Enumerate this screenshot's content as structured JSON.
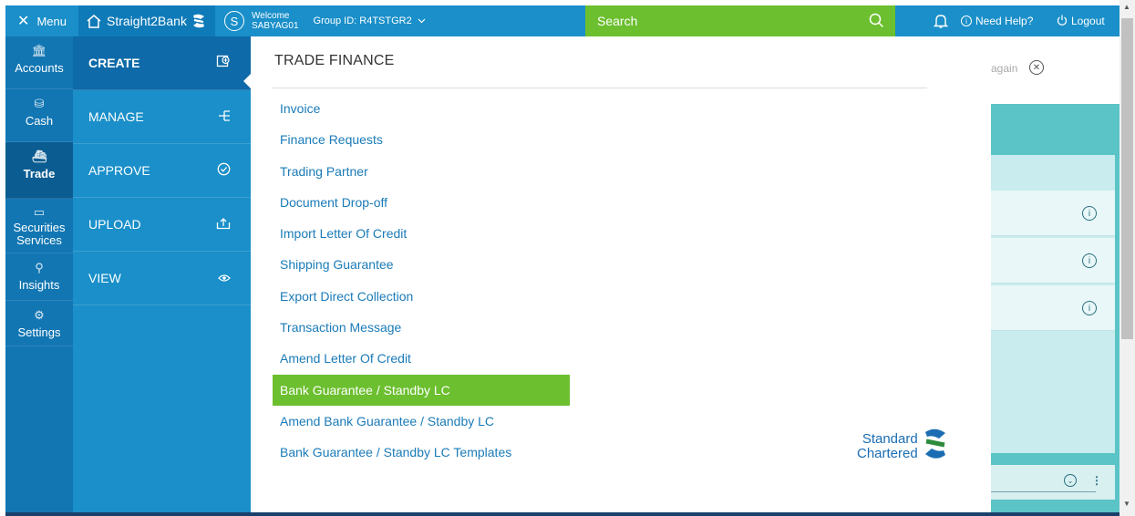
{
  "topbar": {
    "menu_label": "Menu",
    "brand_name": "Straight2Bank",
    "user_initial": "S",
    "welcome_label": "Welcome",
    "user_id": "SABYAG01",
    "group_id": "Group ID: R4TSTGR2",
    "search_placeholder": "Search",
    "help_label": "Need Help?",
    "logout_label": "Logout"
  },
  "leftnav": {
    "items": [
      {
        "label": "Accounts",
        "icon": "bank-icon"
      },
      {
        "label": "Cash",
        "icon": "coins-icon"
      },
      {
        "label": "Trade",
        "icon": "ship-icon"
      },
      {
        "label": "Securities Services",
        "icon": "certificate-icon"
      },
      {
        "label": "Insights",
        "icon": "bulb-icon"
      },
      {
        "label": "Settings",
        "icon": "gear-icon"
      }
    ],
    "active": "Trade"
  },
  "subnav": {
    "items": [
      {
        "label": "CREATE",
        "icon": "create-icon"
      },
      {
        "label": "MANAGE",
        "icon": "manage-icon"
      },
      {
        "label": "APPROVE",
        "icon": "check-circle-icon"
      },
      {
        "label": "UPLOAD",
        "icon": "upload-icon"
      },
      {
        "label": "VIEW",
        "icon": "eye-icon"
      }
    ],
    "active": "CREATE"
  },
  "panel": {
    "title": "TRADE FINANCE",
    "items": [
      "Invoice",
      "Finance Requests",
      "Trading Partner",
      "Document Drop-off",
      "Import Letter Of Credit",
      "Shipping Guarantee",
      "Export Direct Collection",
      "Transaction Message",
      "Amend Letter Of Credit",
      "Bank Guarantee / Standby LC",
      "Amend Bank Guarantee / Standby LC",
      "Bank Guarantee / Standby LC Templates"
    ],
    "highlighted": "Bank Guarantee / Standby LC",
    "logo_line1": "Standard",
    "logo_line2": "Chartered"
  },
  "background": {
    "try_again_fragment": "again"
  },
  "colors": {
    "primary_blue": "#1a8fc9",
    "dark_blue": "#1276b3",
    "accent_green": "#6cbf2f",
    "teal": "#5bc4c7"
  }
}
